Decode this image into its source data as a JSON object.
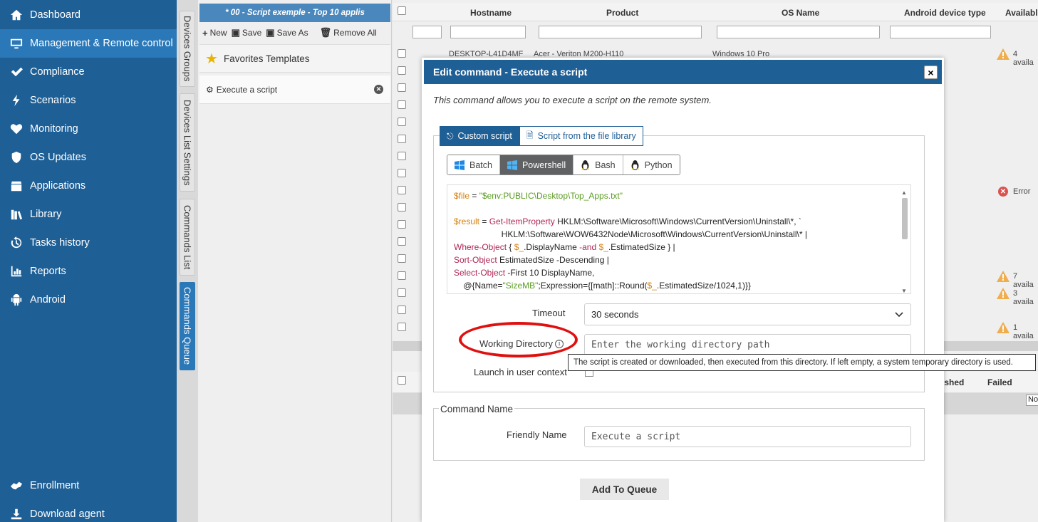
{
  "sidebar": {
    "items": [
      {
        "label": "Dashboard",
        "icon": "home-icon"
      },
      {
        "label": "Management & Remote control",
        "icon": "monitor-icon",
        "active": true
      },
      {
        "label": "Compliance",
        "icon": "check-icon"
      },
      {
        "label": "Scenarios",
        "icon": "bolt-icon"
      },
      {
        "label": "Monitoring",
        "icon": "heart-pulse-icon"
      },
      {
        "label": "OS Updates",
        "icon": "shield-icon"
      },
      {
        "label": "Applications",
        "icon": "box-icon"
      },
      {
        "label": "Library",
        "icon": "library-icon"
      },
      {
        "label": "Tasks history",
        "icon": "history-icon"
      },
      {
        "label": "Reports",
        "icon": "chart-icon"
      },
      {
        "label": "Android",
        "icon": "android-icon"
      }
    ],
    "bottom_items": [
      {
        "label": "Enrollment",
        "icon": "enrollment-icon"
      },
      {
        "label": "Download agent",
        "icon": "download-icon"
      }
    ]
  },
  "vtabs": {
    "devices_groups": "Devices Groups",
    "devices_list_settings": "Devices List Settings",
    "commands_list": "Commands List",
    "commands_queue": "Commands Queue"
  },
  "queue": {
    "title": "* 00 - Script exemple - Top 10 applis",
    "toolbar": {
      "new": "New",
      "save": "Save",
      "save_as": "Save As",
      "remove_all": "Remove All"
    },
    "favorites": "Favorites Templates",
    "item": "Execute a script"
  },
  "grid": {
    "columns": {
      "hostname": "Hostname",
      "product": "Product",
      "os_name": "OS Name",
      "android_type": "Android device type",
      "available": "Available"
    },
    "first_row": {
      "hostname": "DESKTOP-L41D4MF",
      "product": "Acer - Veriton M200-H110",
      "os": "Windows 10 Pro"
    },
    "statuses": [
      "4 availa",
      "Error",
      "7 availa",
      "3 availa",
      "1 availa"
    ],
    "lower_columns": {
      "finished": "ished",
      "failed": "Failed"
    },
    "no_label": "No"
  },
  "modal": {
    "title": "Edit command - Execute a script",
    "close": "×",
    "description": "This command allows you to execute a script on the remote system.",
    "source_tabs": {
      "custom": "Custom script",
      "library": "Script from the file library"
    },
    "lang_tabs": {
      "batch": "Batch",
      "powershell": "Powershell",
      "bash": "Bash",
      "python": "Python"
    },
    "timeout_label": "Timeout",
    "timeout_value": "30 seconds",
    "workdir_label": "Working Directory",
    "workdir_placeholder": "Enter the working directory path",
    "launch_label": "Launch in user context",
    "command_name_legend": "Command Name",
    "friendly_label": "Friendly Name",
    "friendly_placeholder": "Execute a script",
    "add_button": "Add To Queue"
  },
  "tooltip": "The script is created or downloaded, then executed from this directory. If left empty, a system temporary directory is used.",
  "colors": {
    "sidebar": "#1e5f96",
    "active": "#2b78b8",
    "highlight": "#e01010"
  }
}
